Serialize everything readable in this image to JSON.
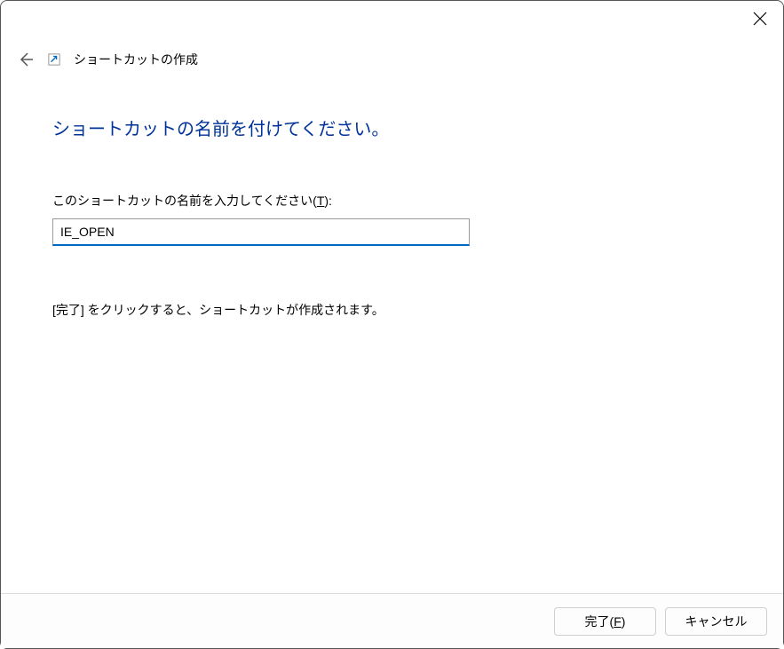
{
  "titlebar": {
    "close_icon": "close"
  },
  "header": {
    "back_icon": "arrow-left",
    "shortcut_icon": "shortcut-arrow",
    "title": "ショートカットの作成"
  },
  "main": {
    "heading": "ショートカットの名前を付けてください。",
    "input_label_prefix": "このショートカットの名前を入力してください(",
    "input_label_key": "T",
    "input_label_suffix": "):",
    "input_value": "IE_OPEN",
    "hint": "[完了] をクリックすると、ショートカットが作成されます。"
  },
  "footer": {
    "finish_prefix": "完了(",
    "finish_key": "F",
    "finish_suffix": ")",
    "cancel_label": "キャンセル"
  }
}
